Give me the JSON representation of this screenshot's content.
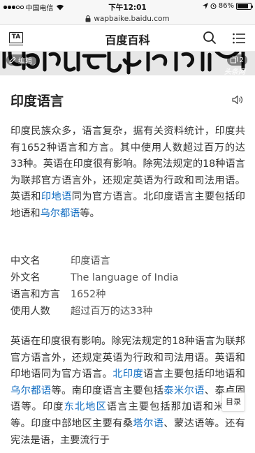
{
  "status_bar": {
    "carrier": "中国电信",
    "time": "下午12:01",
    "battery_text": "86%",
    "battery_level": 0.86
  },
  "url_bar": {
    "url": "wapbaike.baidu.com"
  },
  "header": {
    "logo_text": "TA",
    "title": "百度百科"
  },
  "banner": {
    "edit_label": "编辑",
    "album_count": "2",
    "watermark": "头条网"
  },
  "article": {
    "title": "印度语言",
    "paragraph1": {
      "text_before_link1": "印度民族众多，语言复杂，据有关资料统计，印度共有1652种语言和方言。其中使用人数超过百万的达33种。英语在印度很有影响。除宪法规定的18种语言为联邦官方语言外，还规定英语为行政和司法用语。英语和",
      "link1": "印地语",
      "text_between": "同为官方语言。北印度语言主要包括印地语和",
      "link2": "乌尔都语",
      "text_after": "等。"
    },
    "infobox": [
      {
        "key": "中文名",
        "value": "印度语言"
      },
      {
        "key": "外文名",
        "value": "The language of India"
      },
      {
        "key": "语言和方言",
        "value": "1652种"
      },
      {
        "key": "使用人数",
        "value": "超过百万的达33种"
      }
    ],
    "paragraph2": {
      "t1": "英语在印度很有影响。除宪法规定的18种语言为联邦官方语言外，还规定英语为行政和司法用语。英语和印地语同为官方语言。",
      "l1": "北印度",
      "t2": "语言主要包括印地语和",
      "l2": "乌尔都语",
      "t3": "等。南印度语言主要包括",
      "l3": "泰米尔语",
      "t4": "、泰卢固语等。印度",
      "l4": "东北地区",
      "t5": "语言主要包括那加语和米佐语等。印度中部地区主要有桑",
      "l5": "塔尔语",
      "t6": "、蒙达语等。还有宪法是语，主要流行于"
    }
  },
  "toc_button": "目录",
  "colors": {
    "link": "#136ec2",
    "text": "#333333"
  }
}
